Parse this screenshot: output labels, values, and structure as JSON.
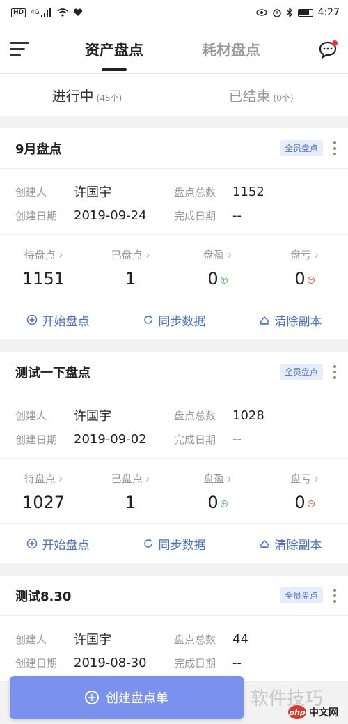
{
  "status_bar": {
    "left": "HD",
    "signal": "4G",
    "time": "4:27"
  },
  "nav": {
    "tabs": [
      {
        "label": "资产盘点",
        "active": true
      },
      {
        "label": "耗材盘点",
        "active": false
      }
    ]
  },
  "subtabs": [
    {
      "label": "进行中",
      "count": "(45个)"
    },
    {
      "label": "已结束",
      "count": "(0个)"
    }
  ],
  "labels": {
    "creator": "创建人",
    "total": "盘点总数",
    "created_date": "创建日期",
    "finished_date": "完成日期",
    "pending": "待盘点",
    "done": "已盘点",
    "surplus": "盘盈",
    "loss": "盘亏",
    "start": "开始盘点",
    "sync": "同步数据",
    "clear": "清除副本",
    "badge": "全员盘点"
  },
  "cards": [
    {
      "title": "9月盘点",
      "creator": "许国宇",
      "total": "1152",
      "created": "2019-09-24",
      "finished": "--",
      "pending": "1151",
      "done": "1",
      "surplus": "0",
      "loss": "0"
    },
    {
      "title": "测试一下盘点",
      "creator": "许国宇",
      "total": "1028",
      "created": "2019-09-02",
      "finished": "--",
      "pending": "1027",
      "done": "1",
      "surplus": "0",
      "loss": "0"
    },
    {
      "title": "测试8.30",
      "creator": "许国宇",
      "total": "44",
      "created": "2019-08-30",
      "finished": "--"
    }
  ],
  "fab_label": "创建盘点单",
  "watermark": "软件技巧",
  "site": {
    "logo": "php",
    "name": "中文网"
  },
  "colors": {
    "accent": "#4a72c7",
    "fab": "#7b91ee",
    "badge_bg": "#e7eefb"
  }
}
